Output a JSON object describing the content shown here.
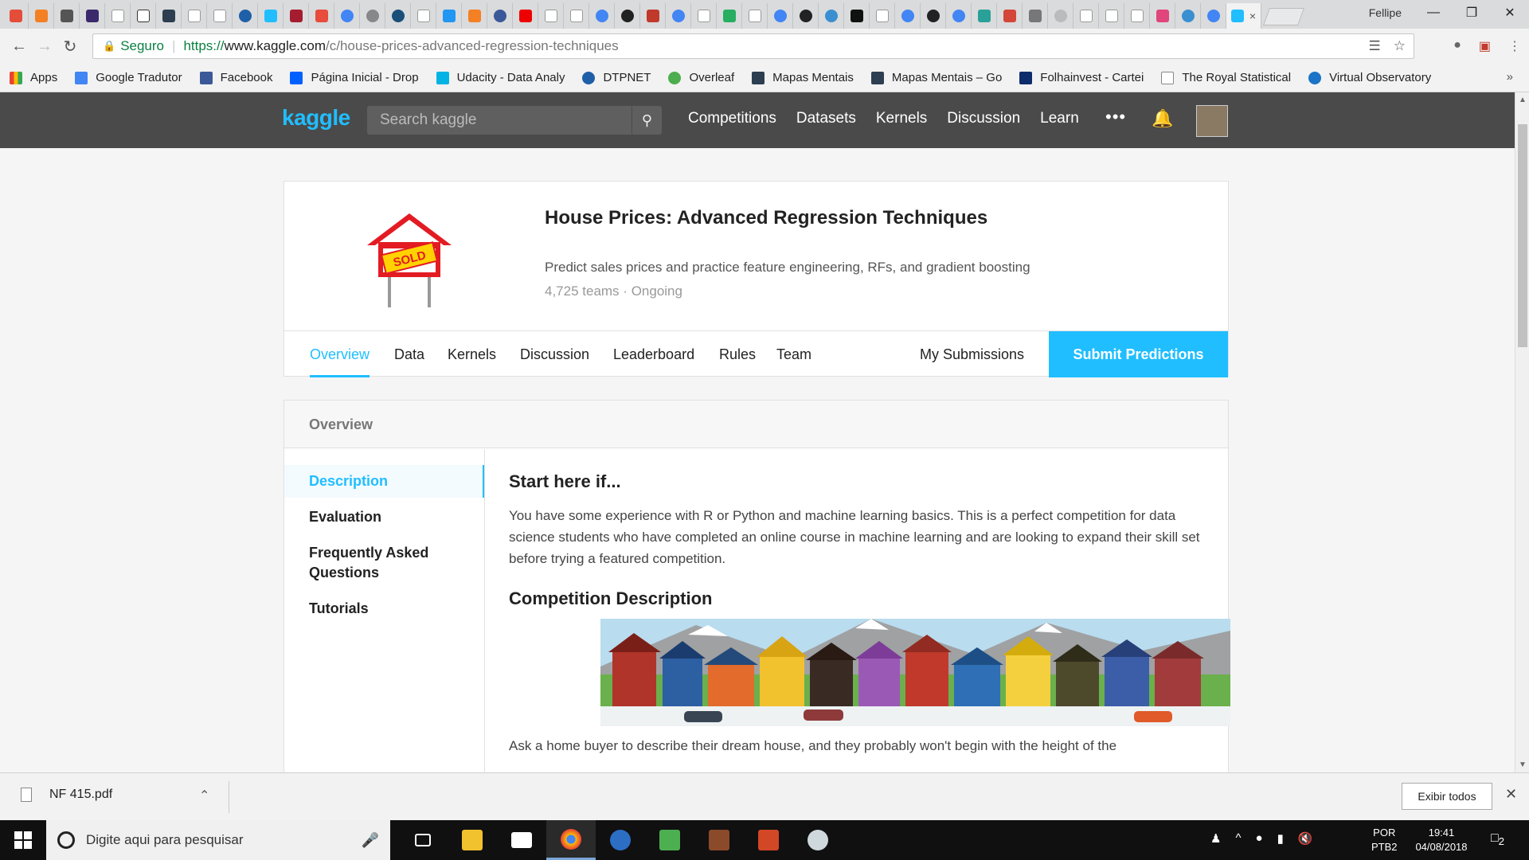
{
  "browser": {
    "user": "Fellipe",
    "active_tab_close": "×",
    "window_controls": [
      "—",
      "❐",
      "✕"
    ],
    "address": {
      "secure_label": "Seguro",
      "url_proto": "https://",
      "url_host": "www.kaggle.com",
      "url_path": "/c/house-prices-advanced-regression-techniques"
    },
    "bookmarks": [
      "Apps",
      "Google Tradutor",
      "Facebook",
      "Página Inicial - Drop",
      "Udacity - Data Analy",
      "DTPNET",
      "Overleaf",
      "Mapas Mentais",
      "Mapas Mentais – Go",
      "Folhainvest - Cartei",
      "The Royal Statistical",
      "Virtual Observatory"
    ],
    "bookmarks_more": "»"
  },
  "kaggle": {
    "logo": "kaggle",
    "search_placeholder": "Search kaggle",
    "nav": [
      "Competitions",
      "Datasets",
      "Kernels",
      "Discussion",
      "Learn"
    ],
    "more": "•••"
  },
  "competition": {
    "title": "House Prices: Advanced Regression Techniques",
    "subtitle": "Predict sales prices and practice feature engineering, RFs, and gradient boosting",
    "teams": "4,725 teams",
    "status": "Ongoing",
    "sign_text": "SOLD",
    "tabs": [
      "Overview",
      "Data",
      "Kernels",
      "Discussion",
      "Leaderboard",
      "Rules",
      "Team"
    ],
    "my_submissions": "My Submissions",
    "submit": "Submit Predictions"
  },
  "overview": {
    "header": "Overview",
    "side": [
      "Description",
      "Evaluation",
      "Frequently Asked Questions",
      "Tutorials"
    ],
    "h_start": "Start here if...",
    "para": "You have some experience with R or Python and machine learning basics. This is a perfect competition for data science students who have completed an online course in machine learning and are looking to expand their skill set before trying a featured competition.",
    "h_comp": "Competition Description",
    "cut_text": "Ask a home buyer to describe their dream house, and they probably won't begin with the height of the"
  },
  "downloads": {
    "file": "NF 415.pdf",
    "show_all": "Exibir todos"
  },
  "taskbar": {
    "search_placeholder": "Digite aqui para pesquisar",
    "lang1": "POR",
    "lang2": "PTB2",
    "time": "19:41",
    "date": "04/08/2018",
    "notif_count": "2"
  },
  "colors": {
    "accent": "#20beff",
    "header": "#4a4a4a"
  }
}
